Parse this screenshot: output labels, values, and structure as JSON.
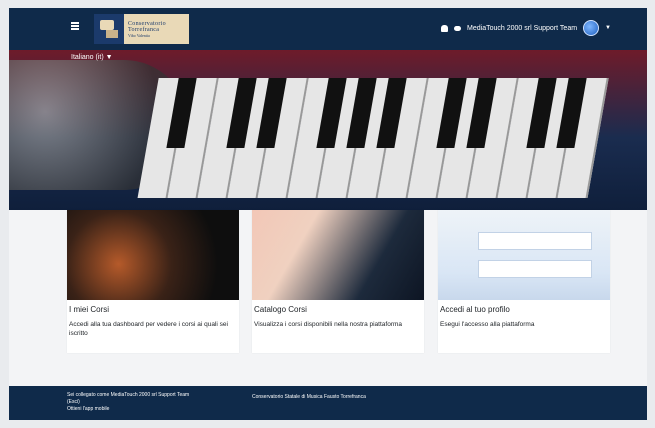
{
  "navbar": {
    "logo": {
      "line1": "Conservatorio",
      "line2": "Torrefranca",
      "line3": "Vibo Valentia"
    },
    "user_name": "MediaTouch 2000 srl Support Team"
  },
  "language": {
    "label": "Italiano (it)"
  },
  "cards": [
    {
      "title": "I miei Corsi",
      "description": "Accedi alla tua dashboard per vedere i corsi ai quali sei iscritto"
    },
    {
      "title": "Catalogo Corsi",
      "description": "Visualizza i corsi disponibili nella nostra piattaforma"
    },
    {
      "title": "Accedi al tuo profilo",
      "description": "Esegui l'accesso alla piattaforma"
    }
  ],
  "footer": {
    "logged_as": "Sei collegato come MediaTouch 2000 srl Support Team",
    "logout": "(Esci)",
    "app": "Ottieni l'app mobile",
    "institution": "Conservatorio Statale di Musica Fausto Torrefranca"
  }
}
